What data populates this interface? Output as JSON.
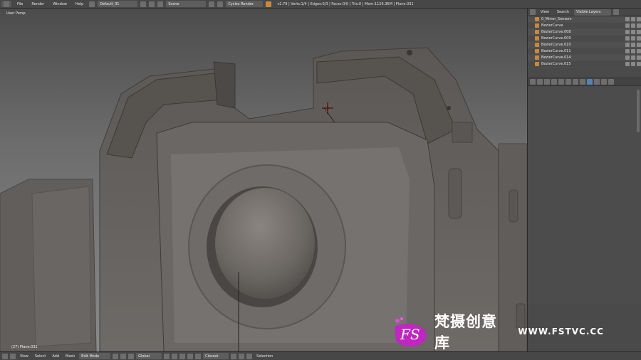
{
  "topbar": {
    "menus": [
      "File",
      "Render",
      "Window",
      "Help"
    ],
    "screen_layout": "Default_01",
    "scene": "Scene",
    "render_engine": "Cycles Render",
    "stats": "v2.79 | Verts:1/4 | Edges:0/3 | Faces:0/0 | Tris:0 | Mem:1126.36M | Plane.031"
  },
  "viewport": {
    "label": "User Persp",
    "object_label": "(27) Plane.031"
  },
  "outliner": {
    "header_buttons": [
      "View",
      "Search"
    ],
    "filter": "Visible Layers",
    "items": [
      "0_Mirror_Sensors",
      "BezierCurve",
      "BezierCurve.008",
      "BezierCurve.009",
      "BezierCurve.010",
      "BezierCurve.011",
      "BezierCurve.014",
      "BezierCurve.015"
    ]
  },
  "bottombar": {
    "menus": [
      "View",
      "Select",
      "Add",
      "Mesh"
    ],
    "mode": "Edit Mode",
    "orientation": "Global",
    "proportional": "Closest",
    "selection_label": "Selection"
  },
  "watermark": {
    "logo_text": "FS",
    "title_cn": "梵摄创意库",
    "url": "WWW.FSTVC.CC"
  },
  "colors": {
    "ui_bg": "#474747",
    "model": "#6e6a66",
    "accent_orange": "#c8883c"
  }
}
